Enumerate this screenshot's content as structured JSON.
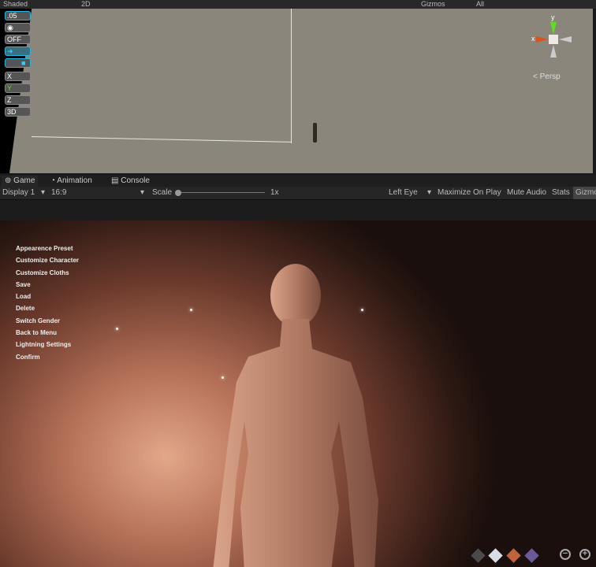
{
  "scene_toolbar": {
    "shading": "Shaded",
    "mode_2d": "2D",
    "gizmos": "Gizmos",
    "search": "All"
  },
  "scene_tools": [
    ".05",
    "eye",
    "OFF",
    "move",
    "lock",
    "X",
    "Y",
    "Z",
    "3D"
  ],
  "scene_gizmo": {
    "y_label": "y",
    "x_label": "x",
    "projection": "< Persp",
    "x_color": "#d9531e",
    "y_color": "#5fdc23"
  },
  "tabs": [
    {
      "label": "Game",
      "icon": "gamepad-icon"
    },
    {
      "label": "Animation",
      "icon": "animation-icon"
    },
    {
      "label": "Console",
      "icon": "console-icon"
    }
  ],
  "game_toolbar": {
    "display": "Display 1",
    "aspect": "16:9",
    "scale_label": "Scale",
    "scale_value": "1x",
    "eye": "Left Eye",
    "maximize": "Maximize On Play",
    "mute": "Mute Audio",
    "stats": "Stats",
    "gizmos": "Gizmo"
  },
  "game_menu": [
    "Appearence Preset",
    "Customize Character",
    "Customize Cloths",
    "Save",
    "Load",
    "Delete",
    "Switch Gender",
    "Back to Menu",
    "Lightning Settings",
    "Confirm"
  ],
  "bottom_icons": {
    "swatches": [
      "#4a4a4a",
      "#d8dde6",
      "#c0623a",
      "#6a5a9a"
    ],
    "zoom_out": "−",
    "zoom_in": "+"
  }
}
